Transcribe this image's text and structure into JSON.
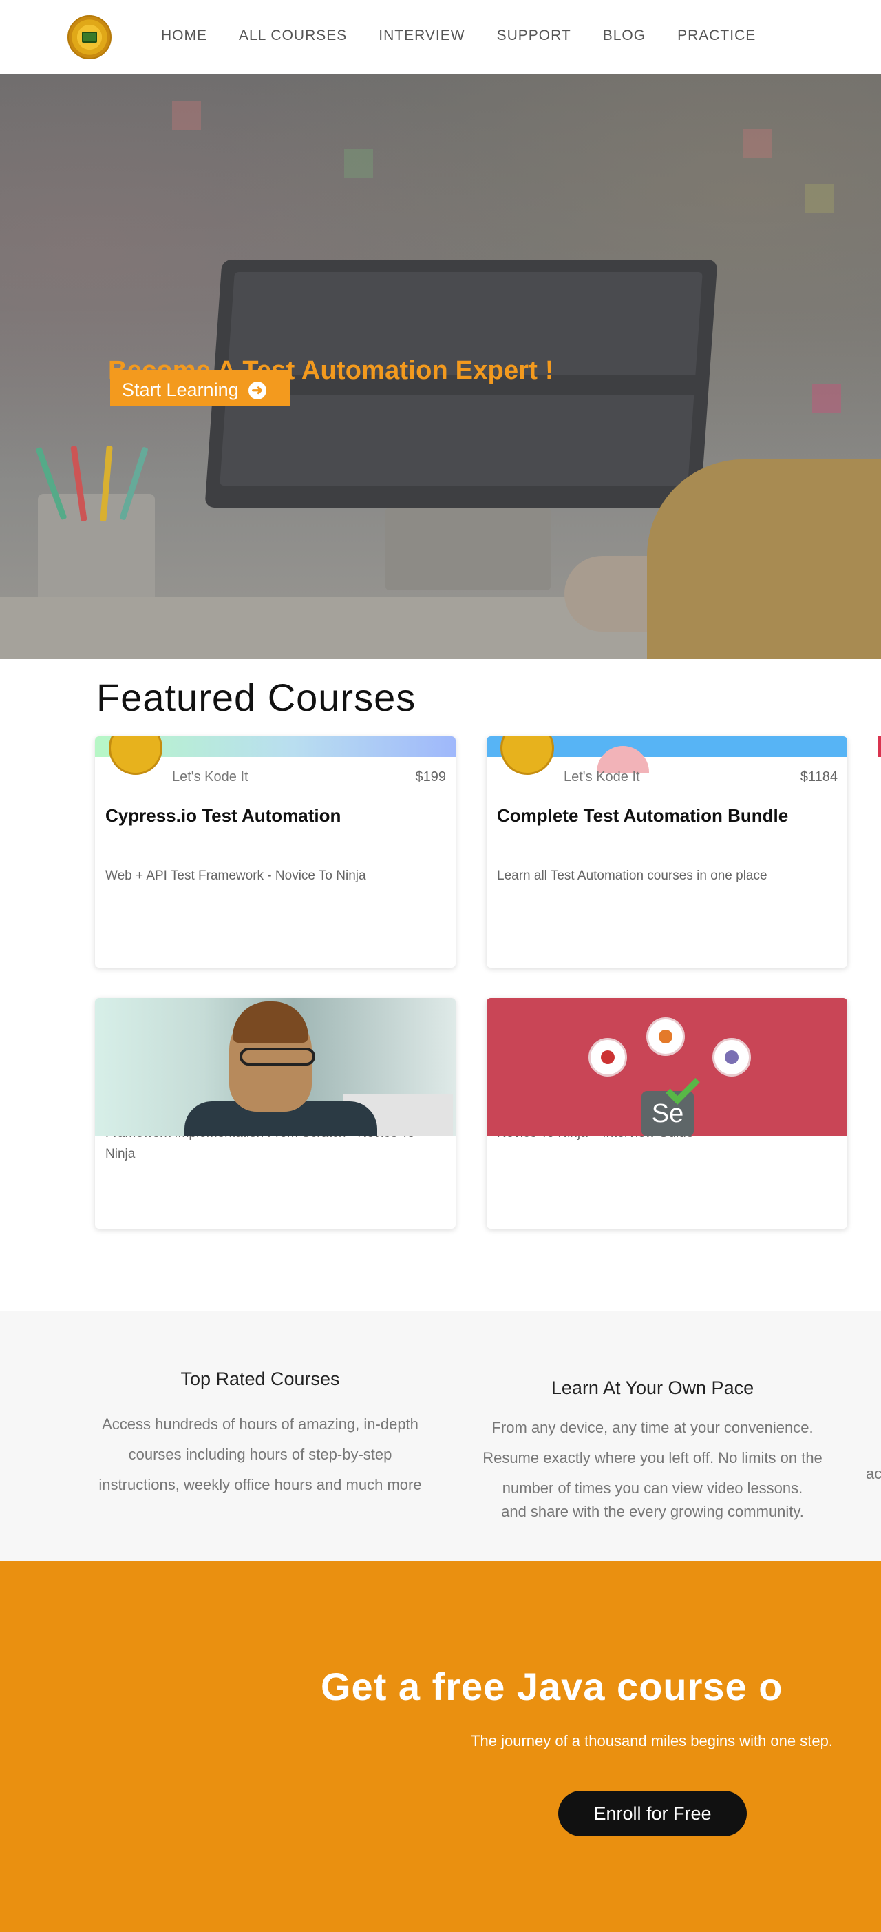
{
  "header": {
    "logo_name": "lets-kode-it-logo",
    "nav": [
      "HOME",
      "ALL COURSES",
      "INTERVIEW",
      "SUPPORT",
      "BLOG",
      "PRACTICE"
    ]
  },
  "hero": {
    "title": "Become A Test Automation Expert !",
    "button_label": "Start Learning",
    "button_icon": "arrow-right-circle-icon",
    "accent_color": "#f39a1e"
  },
  "featured": {
    "title": "Featured Courses",
    "cards": [
      {
        "author": "Let's Kode It",
        "price": "$199",
        "title": "Cypress.io Test Automation",
        "subtitle": "Web + API Test Framework - Novice To Ninja"
      },
      {
        "author": "Let's Kode It",
        "price": "$1184",
        "title": "Complete Test Automation Bundle",
        "subtitle": "Learn all Test Automation courses in one place"
      },
      {
        "subtitle": "Framework Implementation From Scratch - Novice To Ninja"
      },
      {
        "subtitle": "Novice To Ninja + Interview Guide"
      }
    ]
  },
  "features": [
    {
      "title": "Top Rated Courses",
      "lines": [
        "Access hundreds of hours of amazing, in-depth",
        "courses including hours of step-by-step",
        "instructions, weekly office hours and much more"
      ]
    },
    {
      "title": "Learn At Your Own Pace",
      "lines": [
        "From any device, any time at your convenience.",
        "Resume exactly where you left off. No limits on the",
        "number of times you can view video lessons.",
        "and share with the every growing community."
      ]
    },
    {
      "partial": "ac"
    }
  ],
  "cta": {
    "title": "Get a free Java course o",
    "subtitle": "The journey of a thousand miles begins with one step.",
    "button_label": "Enroll for Free",
    "background": "#ea9010"
  }
}
